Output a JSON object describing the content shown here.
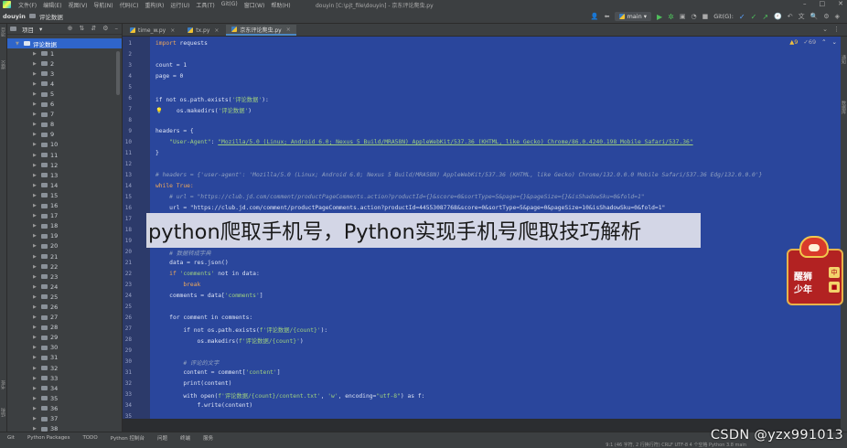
{
  "menu": [
    "文件(F)",
    "编辑(E)",
    "视图(V)",
    "导航(N)",
    "代码(C)",
    "重构(R)",
    "运行(U)",
    "工具(T)",
    "Git(G)",
    "窗口(W)",
    "帮助(H)"
  ],
  "window_title": "douyin [C:\\pjt_file\\douyin] - 京东评论爬虫.py",
  "breadcrumb": {
    "project": "douyin",
    "folder": "评论数据"
  },
  "branch": "main",
  "git_label": "Git(G):",
  "project_panel": {
    "title": "项目",
    "root": "评论数据",
    "children": [
      "1",
      "2",
      "3",
      "4",
      "5",
      "6",
      "7",
      "8",
      "9",
      "10",
      "11",
      "12",
      "13",
      "14",
      "15",
      "16",
      "17",
      "18",
      "19",
      "20",
      "21",
      "22",
      "23",
      "24",
      "25",
      "26",
      "27",
      "28",
      "29",
      "30",
      "31",
      "32",
      "33",
      "34",
      "35",
      "36",
      "37",
      "38"
    ]
  },
  "tabs": [
    {
      "label": "time_w.py",
      "active": false
    },
    {
      "label": "tx.py",
      "active": false
    },
    {
      "label": "京东评论爬虫.py",
      "active": true
    }
  ],
  "inspections": {
    "warnings": "▲9",
    "weak": "✓69"
  },
  "line_numbers": [
    "1",
    "2",
    "3",
    "4",
    "5",
    "6",
    "7",
    "8",
    "9",
    "10",
    "11",
    "12",
    "13",
    "14",
    "15",
    "16",
    "17",
    "18",
    "19",
    "20",
    "21",
    "22",
    "23",
    "24",
    "25",
    "26",
    "27",
    "28",
    "29",
    "30",
    "31",
    "32",
    "33",
    "34",
    "35"
  ],
  "code": {
    "l1": "import requests",
    "l3": "count = 1",
    "l4": "page = 0",
    "l6a": "if not os.path.exists(",
    "l6s": "'评论数据'",
    "l6b": "):",
    "l7a": "    os.makedirs(",
    "l7s": "'评论数据'",
    "l7b": ")",
    "l9": "headers = {",
    "l10k": "    \"User-Agent\"",
    "l10s": "\"Mozilla/5.0 (Linux; Android 6.0; Nexus 5 Build/MRA58N) AppleWebKit/537.36 (KHTML, like Gecko) Chrome/86.0.4240.198 Mobile Safari/537.36\"",
    "l11": "}",
    "l13": "# headers = {'user-agent': 'Mozilla/5.0 (Linux; Android 6.0; Nexus 5 Build/MRA58N) AppleWebKit/537.36 (KHTML, like Gecko) Chrome/132.0.0.0 Mobile Safari/537.36 Edg/132.0.0.0'}",
    "l14": "while True:",
    "l15": "    # url = \"https://club.jd.com/comment/productPageComments.action?productId={}&score=0&sortType=5&page={}&pageSize={}&isShadowSku=0&fold=1\"",
    "l16": "    url = \"https://club.jd.com/comment/productPageComments.action?productId=44553087768&score=0&sortType=5&page=0&pageSize=10&isShadowSku=0&fold=1\"",
    "l21": "    # 数据转成字典",
    "l22": "    data = res.json()",
    "l23a": "    if ",
    "l23s": "'comments'",
    "l23b": " not in data:",
    "l24": "        break",
    "l25a": "    comments = data[",
    "l25s": "'comments'",
    "l25b": "]",
    "l27": "    for comment in comments:",
    "l28a": "        if not os.path.exists(",
    "l28s": "f'评论数据/{count}'",
    "l28b": "):",
    "l29a": "            os.makedirs(",
    "l29s": "f'评论数据/{count}'",
    "l29b": ")",
    "l31": "        # 评论的文字",
    "l32a": "        content = comment[",
    "l32s": "'content'",
    "l32b": "]",
    "l33": "        print(content)",
    "l34a": "        with open(",
    "l34s": "f'评论数据/{count}/content.txt'",
    "l34c": ", ",
    "l34m": "'w'",
    "l34d": ", encoding=",
    "l34e": "\"utf-8\"",
    "l34f": ") as f:",
    "l35": "            f.write(content)"
  },
  "bottom_tools": [
    "Git",
    "Python Packages",
    "TODO",
    "Python 控制台",
    "问题",
    "终端",
    "服务"
  ],
  "status_info": "9:1 (46 字符, 2 行换行符)  CRLF  UTF-8  4 个空格  Python 3.8  main",
  "caption": "python爬取手机号，Python实现手机号爬取技巧解析",
  "badge": {
    "line1": "醒狮",
    "line2": "少年",
    "tag1": "中",
    "tag2": "■"
  },
  "watermark": "CSDN @yzx991013"
}
